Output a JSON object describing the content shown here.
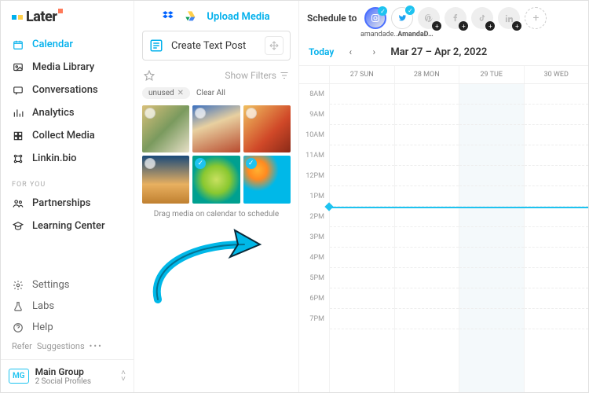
{
  "brand": {
    "name": "Later"
  },
  "sidebar": {
    "items": [
      {
        "label": "Calendar",
        "active": true
      },
      {
        "label": "Media Library",
        "active": false
      },
      {
        "label": "Conversations",
        "active": false
      },
      {
        "label": "Analytics",
        "active": false
      },
      {
        "label": "Collect Media",
        "active": false
      },
      {
        "label": "Linkin.bio",
        "active": false
      }
    ],
    "for_you_label": "FOR YOU",
    "for_you": [
      {
        "label": "Partnerships"
      },
      {
        "label": "Learning Center"
      }
    ],
    "bottom": [
      {
        "label": "Settings"
      },
      {
        "label": "Labs"
      },
      {
        "label": "Help"
      }
    ],
    "footer": {
      "refer": "Refer",
      "suggestions": "Suggestions"
    },
    "group": {
      "badge": "MG",
      "name": "Main Group",
      "sub": "2 Social Profiles"
    }
  },
  "media": {
    "upload_label": "Upload Media",
    "create_label": "Create Text Post",
    "show_filters": "Show Filters",
    "tag": {
      "label": "unused"
    },
    "clear_all": "Clear All",
    "thumbs": [
      {
        "selected": false,
        "bg": "linear-gradient(135deg,#d9c07a 0%,#7a9a5e 50%,#e8e0c8 100%)"
      },
      {
        "selected": false,
        "bg": "linear-gradient(160deg,#3a6fbf 0%,#e8d0a0 40%,#b84a2e 100%)"
      },
      {
        "selected": false,
        "bg": "linear-gradient(135deg,#f0c060 0%,#d04828 60%,#8a2a18 100%)"
      },
      {
        "selected": false,
        "bg": "linear-gradient(180deg,#1a4a7a 0%,#e8b060 60%,#c08030 100%)"
      },
      {
        "selected": true,
        "bg": "radial-gradient(circle at 50% 50%, #c8e060 0%, #8ac830 40%, #00a090 70%)"
      },
      {
        "selected": true,
        "bg": "radial-gradient(circle at 30% 30%, #ffb030 0%, #ff8a20 20%, #00b8e8 45%)"
      }
    ],
    "drag_hint": "Drag media on calendar to schedule"
  },
  "calendar": {
    "schedule_to": "Schedule to",
    "handle1": "amandade..",
    "handle2": "AmandaD…",
    "today": "Today",
    "range": "Mar 27 – Apr 2, 2022",
    "days": [
      "27 SUN",
      "28 MON",
      "29 TUE",
      "30 WED"
    ],
    "hours": [
      "8AM",
      "9AM",
      "10AM",
      "11AM",
      "12PM",
      "1PM",
      "2PM",
      "3PM",
      "4PM",
      "5PM",
      "6PM",
      "7PM"
    ],
    "highlight_day_index": 2,
    "now_hour_index": 6
  }
}
